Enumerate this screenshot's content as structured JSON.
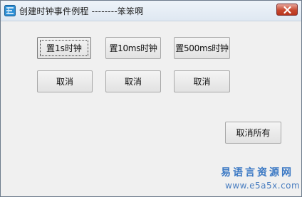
{
  "window": {
    "title": "创建时钟事件例程 --------笨笨啊"
  },
  "buttons": {
    "set_1s": "置1s时钟",
    "set_10ms": "置10ms时钟",
    "set_500ms": "置500ms时钟",
    "cancel_1": "取消",
    "cancel_2": "取消",
    "cancel_3": "取消",
    "cancel_all": "取消所有"
  },
  "watermark": {
    "line1": "易语言资源网",
    "line2": "www.e5a5x.com"
  },
  "colors": {
    "watermark": "#3a78c4",
    "close_button": "#c7482f"
  },
  "icons": {
    "app": "app-icon",
    "close": "close-icon"
  }
}
